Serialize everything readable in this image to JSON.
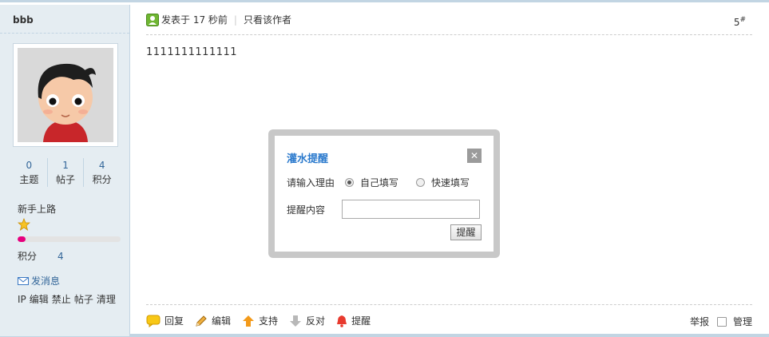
{
  "sidebar": {
    "username": "bbb",
    "stats": [
      {
        "num": "0",
        "label": "主题"
      },
      {
        "num": "1",
        "label": "帖子"
      },
      {
        "num": "4",
        "label": "积分"
      }
    ],
    "rank": "新手上路",
    "rank_progress_percent": 8,
    "points_label": "积分",
    "points_value": "4",
    "send_message": "发消息",
    "admin_links": [
      "IP",
      "编辑",
      "禁止",
      "帖子",
      "清理"
    ]
  },
  "post": {
    "posted_meta": "发表于 17 秒前",
    "only_author": "只看该作者",
    "floor_number": "5",
    "floor_suffix": "#",
    "content": "1111111111111"
  },
  "actions": {
    "reply": "回复",
    "edit": "编辑",
    "support": "支持",
    "oppose": "反对",
    "remind": "提醒",
    "report": "举报",
    "manage": "管理"
  },
  "dialog": {
    "title": "灌水提醒",
    "close": "✕",
    "reason_label": "请输入理由",
    "option_custom": "自己填写",
    "option_quick": "快速填写",
    "content_label": "提醒内容",
    "content_value": "",
    "submit": "提醒"
  },
  "colors": {
    "sidebar_bg": "#e5edf2",
    "link": "#336699",
    "dialog_title": "#2b7acd",
    "progress_fill": "#e6007e"
  }
}
